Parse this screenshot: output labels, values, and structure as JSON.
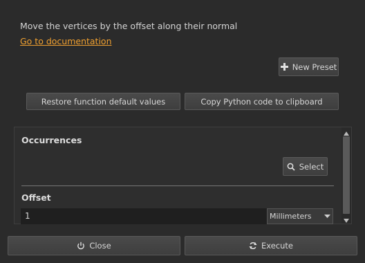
{
  "description": "Move the vertices by the offset along their normal",
  "doc_link": "Go to documentation",
  "presets": {
    "new_preset_label": "New Preset"
  },
  "actions": {
    "restore_label": "Restore function default values",
    "copy_label": "Copy Python code to clipboard"
  },
  "params": {
    "occurrences": {
      "title": "Occurrences",
      "select_label": "Select"
    },
    "offset": {
      "title": "Offset",
      "value": "1",
      "unit": "Millimeters"
    }
  },
  "footer": {
    "close_label": "Close",
    "execute_label": "Execute"
  },
  "colors": {
    "background": "#2b2b2b",
    "link": "#f0a030",
    "button": "#444444"
  }
}
